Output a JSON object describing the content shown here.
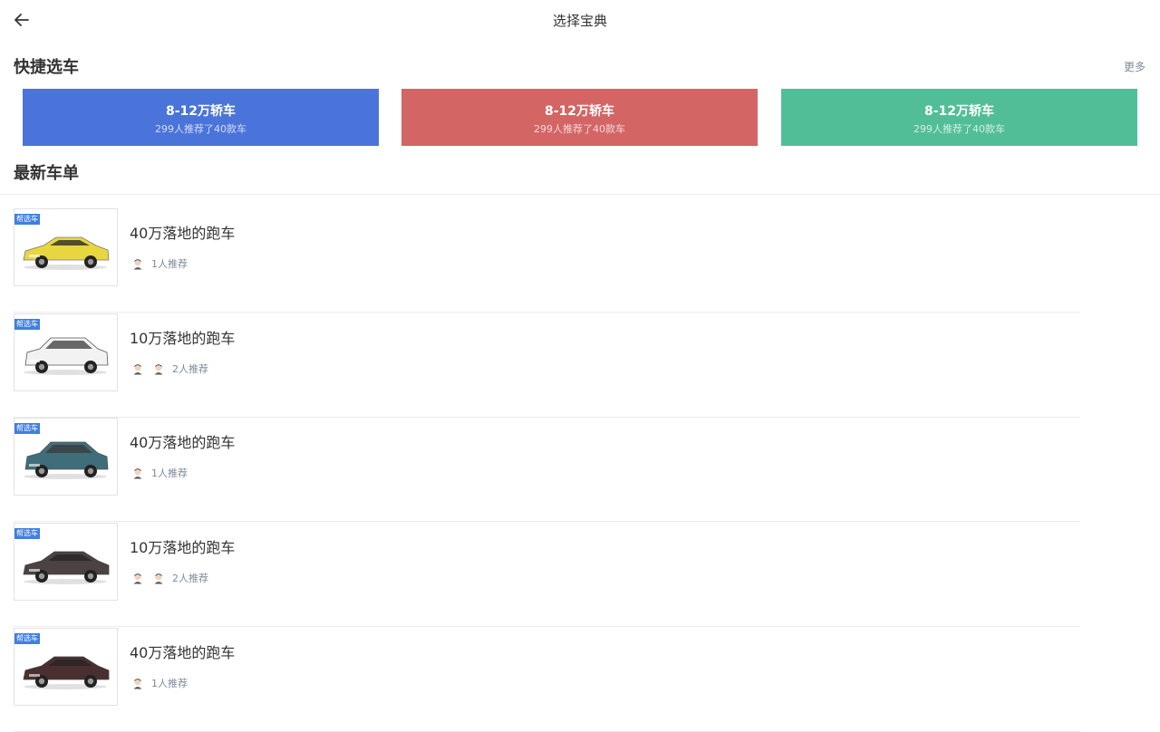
{
  "header": {
    "title": "选择宝典",
    "back_icon": "arrow-left-icon"
  },
  "quick_select": {
    "title": "快捷选车",
    "more_label": "更多",
    "cards": [
      {
        "title": "8-12万轿车",
        "subtitle": "299人推荐了40款车",
        "color": "#4a74d9"
      },
      {
        "title": "8-12万轿车",
        "subtitle": "299人推荐了40款车",
        "color": "#d46565"
      },
      {
        "title": "8-12万轿车",
        "subtitle": "299人推荐了40款车",
        "color": "#52be98"
      }
    ]
  },
  "latest": {
    "title": "最新车单",
    "items": [
      {
        "badge": "帮选车",
        "title": "40万落地的跑车",
        "rec_text": "1人推荐",
        "avatars": 1,
        "car_type": "coupe",
        "car_color": "#e8d640"
      },
      {
        "badge": "帮选车",
        "title": "10万落地的跑车",
        "rec_text": "2人推荐",
        "avatars": 2,
        "car_type": "suv",
        "car_color": "#f2f2f2"
      },
      {
        "badge": "帮选车",
        "title": "40万落地的跑车",
        "rec_text": "1人推荐",
        "avatars": 1,
        "car_type": "suv",
        "car_color": "#3f6e7a"
      },
      {
        "badge": "帮选车",
        "title": "10万落地的跑车",
        "rec_text": "2人推荐",
        "avatars": 2,
        "car_type": "sedan",
        "car_color": "#4a4243"
      },
      {
        "badge": "帮选车",
        "title": "40万落地的跑车",
        "rec_text": "1人推荐",
        "avatars": 1,
        "car_type": "sedan",
        "car_color": "#4a2f30"
      }
    ]
  }
}
